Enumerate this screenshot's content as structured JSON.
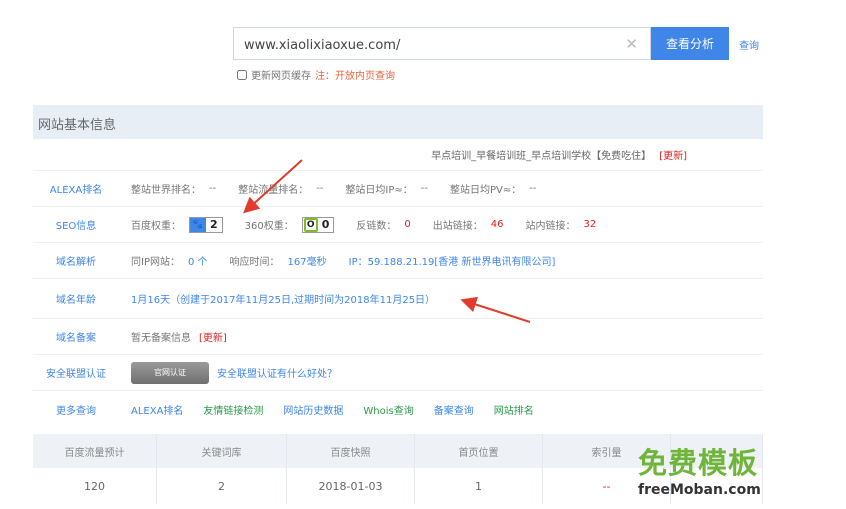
{
  "search": {
    "value": "www.xiaolixiaoxue.com/",
    "clear_glyph": "✕",
    "button_label": "查看分析",
    "query_link": "查询",
    "cache_label": "更新网页缓存",
    "cache_note": "注：开放内页查询"
  },
  "section_title": "网站基本信息",
  "site_title": "早点培训_早餐培训班_早点培训学校【免费吃住】",
  "update_label": "[更新]",
  "alexa": {
    "label": "ALEXA排名",
    "world_rank": "整站世界排名：",
    "world_rank_value": "--",
    "traffic_rank": "整站流量排名：",
    "traffic_rank_value": "--",
    "ip": "整站日均IP≈：",
    "ip_value": "--",
    "pv": "整站日均PV≈：",
    "pv_value": "--"
  },
  "seo": {
    "label": "SEO信息",
    "baidu_weight": "百度权重：",
    "baidu_weight_value": "2",
    "s360_weight": "360权重：",
    "s360_weight_value": "0",
    "backlinks": "反链数：",
    "backlinks_value": "0",
    "outbound": "出站链接：",
    "outbound_value": "46",
    "inbound": "站内链接：",
    "inbound_value": "32"
  },
  "dns": {
    "label": "域名解析",
    "same_ip": "同IP网站：",
    "same_ip_value": "0 个",
    "response": "响应时间：",
    "response_value": "167毫秒",
    "ip_text": "IP：59.188.21.19[香港 新世界电讯有限公司]"
  },
  "age": {
    "label": "域名年龄",
    "value": "1月16天（创建于2017年11月25日,过期时间为2018年11月25日）"
  },
  "record": {
    "label": "域名备案",
    "value": "暂无备案信息",
    "update": "[更新]"
  },
  "security": {
    "label": "安全联盟认证",
    "seal_text": "官网认证",
    "benefit": "安全联盟认证有什么好处？"
  },
  "more": {
    "label": "更多查询",
    "links": [
      "ALEXA排名",
      "友情链接检测",
      "网站历史数据",
      "Whois查询",
      "备案查询",
      "网站排名"
    ]
  },
  "stats": {
    "headers": [
      "百度流量预计",
      "关键词库",
      "百度快照",
      "首页位置",
      "索引量",
      ""
    ],
    "values": [
      "120",
      "2",
      "2018-01-03",
      "1",
      "--",
      ""
    ]
  },
  "watermark": {
    "cn": "免费模板",
    "en": "freeMoban.com"
  },
  "colors": {
    "accent": "#3f86e8",
    "alert": "#e02020",
    "header_bg": "#e8eef6"
  }
}
